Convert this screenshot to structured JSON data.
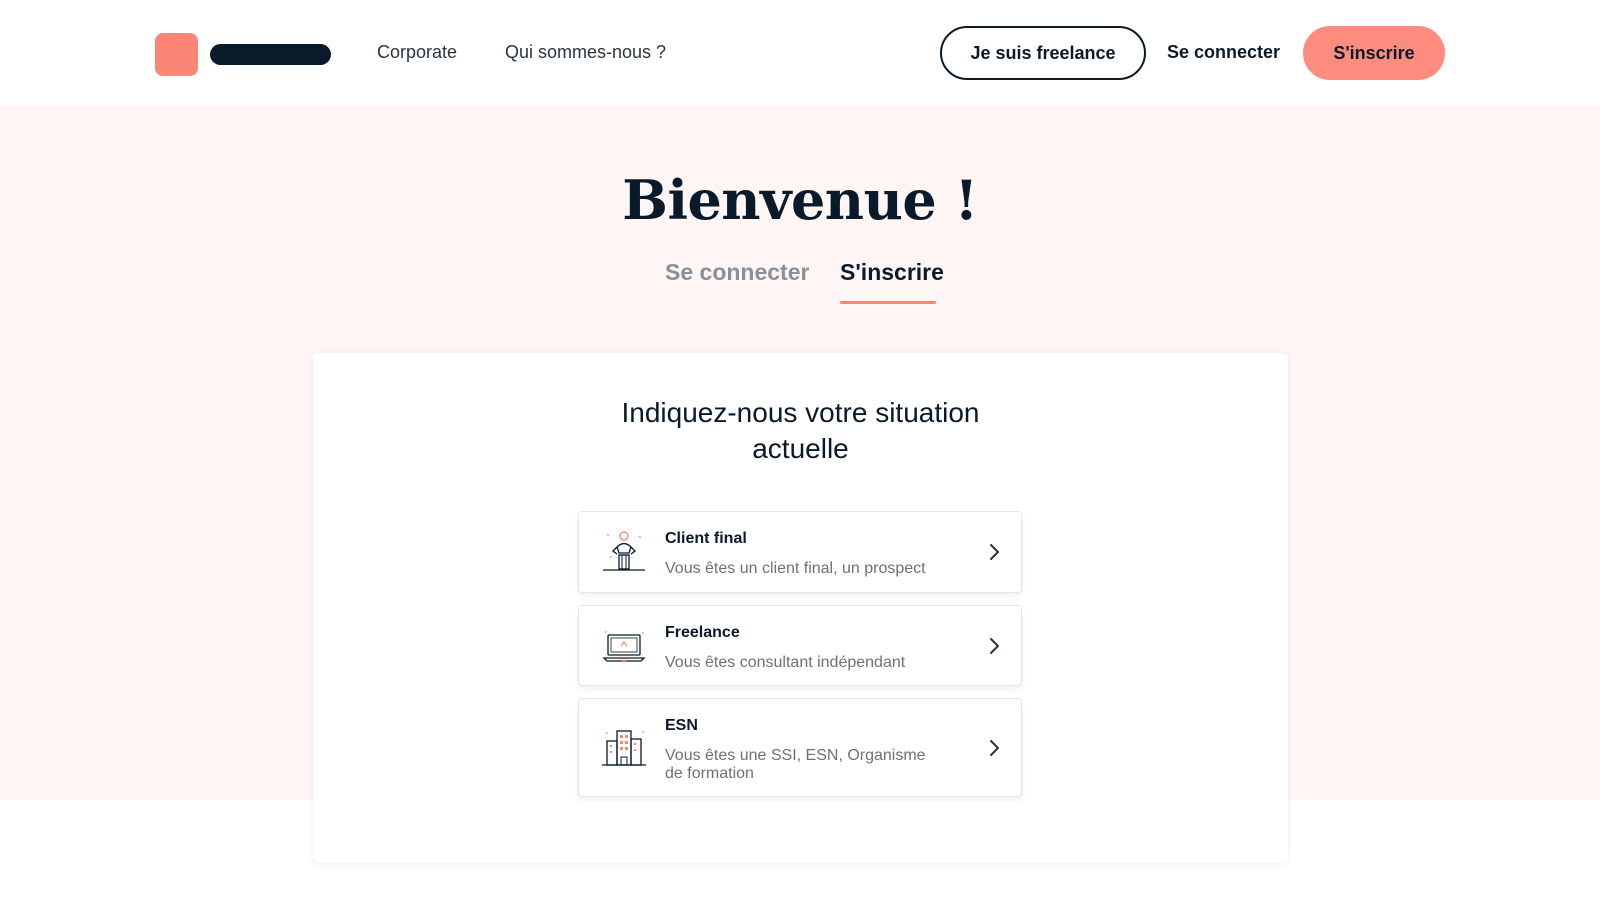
{
  "header": {
    "nav": {
      "corporate": "Corporate",
      "about": "Qui sommes-nous ?"
    },
    "freelance_button": "Je suis freelance",
    "login_link": "Se connecter",
    "signup_button": "S'inscrire"
  },
  "main": {
    "title": "Bienvenue !",
    "tabs": {
      "login": "Se connecter",
      "signup": "S'inscrire",
      "active": "signup"
    },
    "card": {
      "title_line1": "Indiquez-nous votre situation",
      "title_line2": "actuelle",
      "options": [
        {
          "title": "Client final",
          "description": "Vous êtes un client final, un prospect",
          "icon": "client-person-icon"
        },
        {
          "title": "Freelance",
          "description": "Vous êtes consultant indépendant",
          "icon": "laptop-icon"
        },
        {
          "title": "ESN",
          "description": "Vous êtes une SSI, ESN, Organisme de formation",
          "icon": "building-icon"
        }
      ]
    }
  },
  "colors": {
    "accent": "#fc8575",
    "dark": "#0b1a2b",
    "hero_background": "#fdf6f5",
    "muted_text": "#8b8f99"
  }
}
